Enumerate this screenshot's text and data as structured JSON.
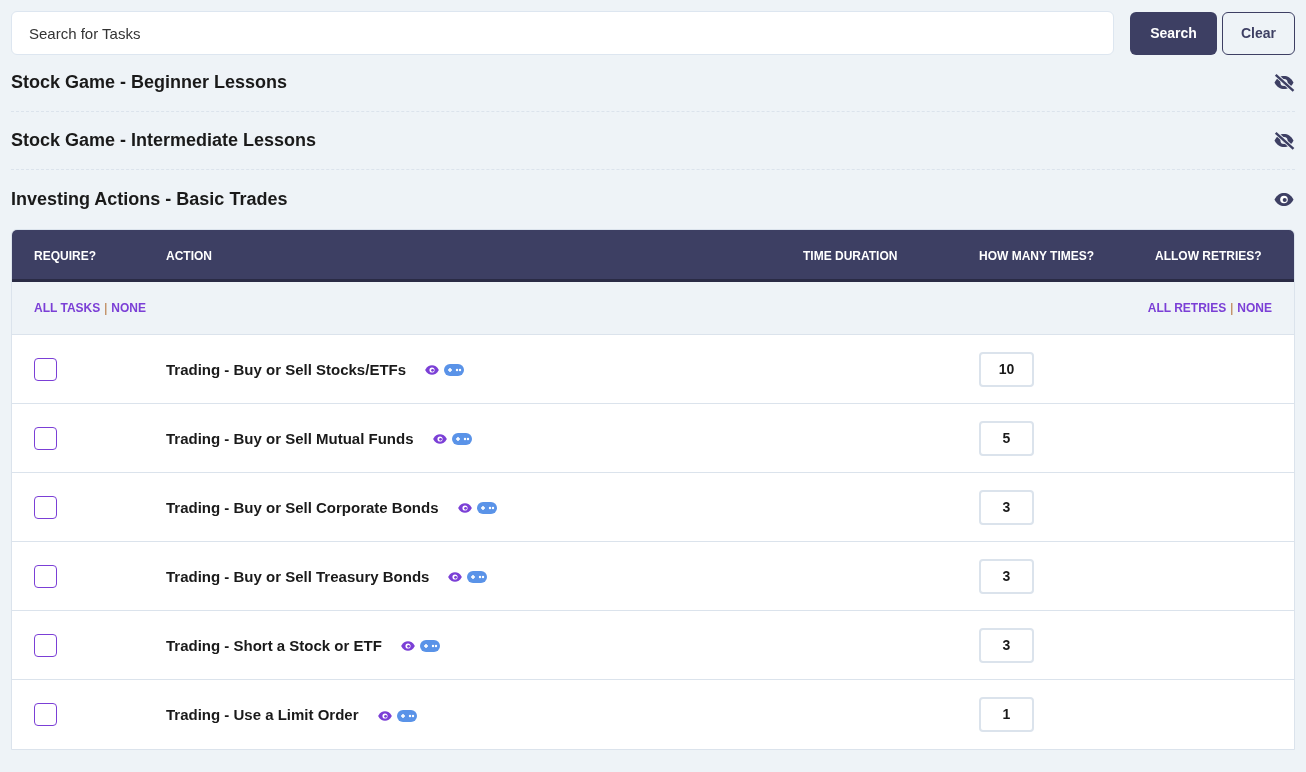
{
  "search": {
    "placeholder": "Search for Tasks",
    "buttons": [
      "Search",
      "Clear"
    ]
  },
  "sections": [
    {
      "title": "Stock Game - Beginner Lessons",
      "visible": false
    },
    {
      "title": "Stock Game - Intermediate Lessons",
      "visible": false
    },
    {
      "title": "Investing Actions - Basic Trades",
      "visible": true,
      "table": {
        "columns": [
          "REQUIRE?",
          "ACTION",
          "TIME DURATION",
          "HOW MANY TIMES?",
          "ALLOW RETRIES?"
        ],
        "select_links": {
          "left": [
            "ALL TASKS",
            "NONE"
          ],
          "right": [
            "ALL RETRIES",
            "NONE"
          ],
          "separator": "|"
        },
        "rows": [
          {
            "checked": false,
            "action": "Trading - Buy or Sell Stocks/ETFs",
            "times": "10"
          },
          {
            "checked": false,
            "action": "Trading - Buy or Sell Mutual Funds",
            "times": "5"
          },
          {
            "checked": false,
            "action": "Trading - Buy or Sell Corporate Bonds",
            "times": "3"
          },
          {
            "checked": false,
            "action": "Trading - Buy or Sell Treasury Bonds",
            "times": "3"
          },
          {
            "checked": false,
            "action": "Trading - Short a Stock or ETF",
            "times": "3"
          },
          {
            "checked": false,
            "action": "Trading - Use a Limit Order",
            "times": "1"
          }
        ]
      }
    }
  ]
}
